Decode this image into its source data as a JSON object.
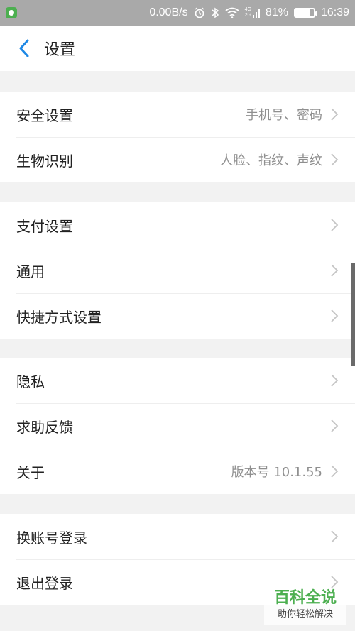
{
  "status_bar": {
    "speed": "0.00B/s",
    "battery": "81%",
    "battery_level": 0.81,
    "time": "16:39",
    "network_top": "4G",
    "network_bottom": "2G"
  },
  "header": {
    "title": "设置"
  },
  "sections": [
    {
      "items": [
        {
          "label": "安全设置",
          "value": "手机号、密码"
        },
        {
          "label": "生物识别",
          "value": "人脸、指纹、声纹"
        }
      ]
    },
    {
      "items": [
        {
          "label": "支付设置"
        },
        {
          "label": "通用"
        },
        {
          "label": "快捷方式设置"
        }
      ]
    },
    {
      "items": [
        {
          "label": "隐私"
        },
        {
          "label": "求助反馈"
        },
        {
          "label": "关于",
          "value": "版本号 10.1.55"
        }
      ]
    },
    {
      "items": [
        {
          "label": "换账号登录"
        },
        {
          "label": "退出登录"
        }
      ]
    }
  ],
  "watermark": {
    "title": "百科全说",
    "subtitle": "助你轻松解决"
  },
  "colors": {
    "accent": "#1e88e5",
    "status_bar": "#a9a9a9",
    "watermark_green": "#4caf50"
  },
  "icons": [
    "app-notification-icon",
    "alarm-icon",
    "bluetooth-icon",
    "wifi-icon",
    "signal-icon",
    "battery-icon",
    "back-chevron-icon",
    "chevron-right-icon"
  ]
}
